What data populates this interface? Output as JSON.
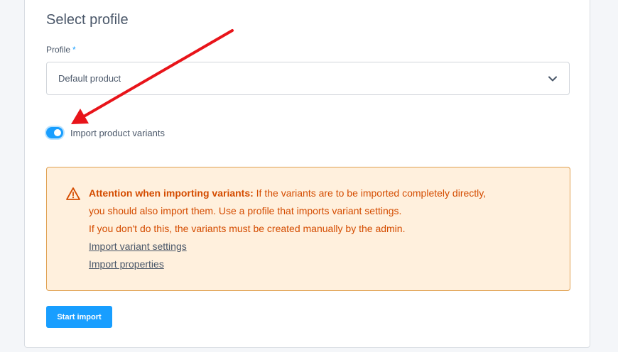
{
  "section": {
    "title": "Select profile"
  },
  "profile_field": {
    "label": "Profile",
    "required_mark": "*",
    "value": "Default product",
    "icon": "chevron-down-icon"
  },
  "variants_toggle": {
    "label": "Import product variants",
    "checked": true
  },
  "alert": {
    "icon": "warning-triangle-icon",
    "heading": "Attention when importing variants:",
    "line1": " If the variants are to be imported completely directly,",
    "line2": "you should also import them. Use a profile that imports variant settings.",
    "line3": "If you don't do this, the variants must be created manually by the admin.",
    "links": [
      "Import variant settings",
      "Import properties"
    ]
  },
  "actions": {
    "start_label": "Start import"
  },
  "colors": {
    "accent": "#189eff",
    "warning_text": "#d44c00",
    "warning_bg": "#fff0dd",
    "annotation_arrow": "#e8141a"
  }
}
